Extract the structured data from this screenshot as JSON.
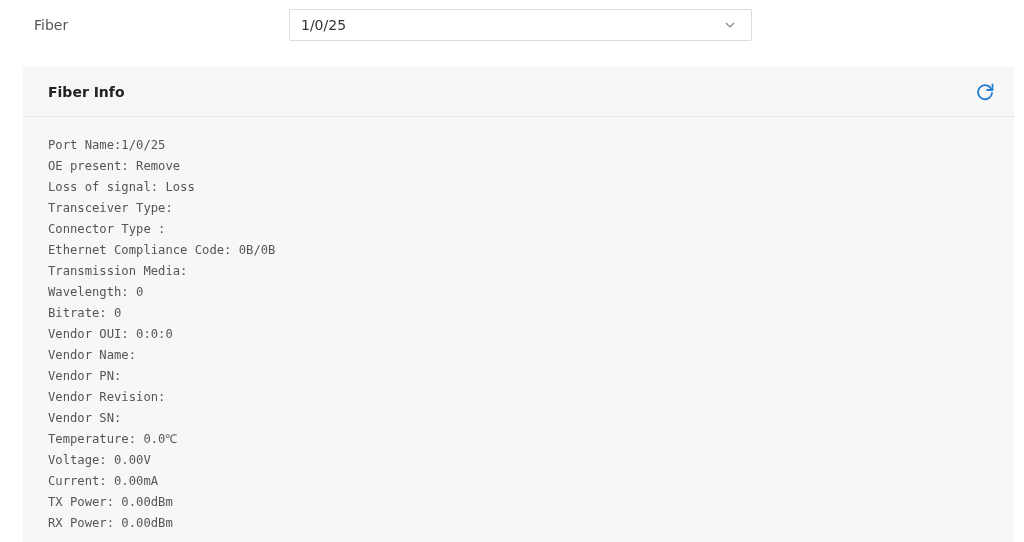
{
  "fiber_field": {
    "label": "Fiber",
    "value": "1/0/25"
  },
  "panel": {
    "title": "Fiber Info",
    "lines": [
      "Port Name:1/0/25",
      "OE present: Remove",
      "Loss of signal: Loss",
      "Transceiver Type:",
      "Connector Type :",
      "Ethernet Compliance Code: 0B/0B",
      "Transmission Media:",
      "Wavelength: 0",
      "Bitrate: 0",
      "Vendor OUI: 0:0:0",
      "Vendor Name:",
      "Vendor PN:",
      "Vendor Revision:",
      "Vendor SN:",
      "Temperature: 0.0℃",
      "Voltage: 0.00V",
      "Current: 0.00mA",
      "TX Power: 0.00dBm",
      "RX Power: 0.00dBm"
    ]
  }
}
